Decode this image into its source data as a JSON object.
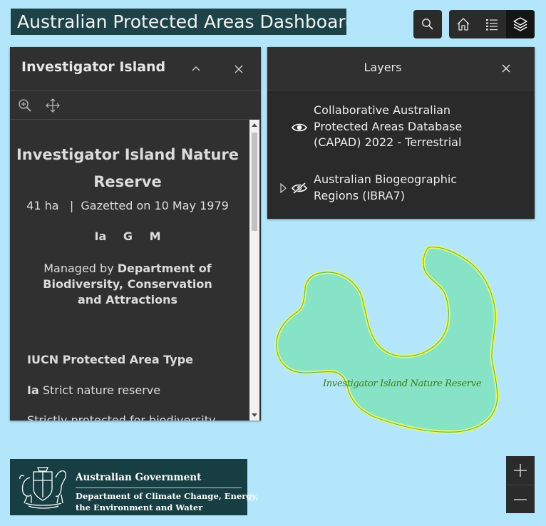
{
  "app": {
    "title": "Australian Protected Areas Dashboard"
  },
  "toolbar": {
    "search_icon": "search-icon",
    "home_icon": "home-icon",
    "legend_icon": "list-icon",
    "layers_icon": "layers-icon"
  },
  "popup": {
    "title": "Investigator Island",
    "feature_name": "Investigator Island Nature Reserve",
    "area": "41 ha",
    "separator": "|",
    "gazetted": "Gazetted on 10 May 1979",
    "codes": [
      "Ia",
      "G",
      "M"
    ],
    "managed_prefix": "Managed by",
    "manager": "Department of Biodiversity, Conservation and Attractions",
    "iucn_heading": "IUCN Protected Area Type",
    "iucn_code": "Ia",
    "iucn_name": "Strict nature reserve",
    "iucn_description": "Strictly protected for biodiversity"
  },
  "layers": {
    "title": "Layers",
    "items": [
      {
        "label": "Collaborative Australian Protected Areas Database (CAPAD) 2022 - Terrestrial",
        "visible": true
      },
      {
        "label": "Australian Biogeographic Regions (IBRA7)",
        "visible": false,
        "expandable": true
      }
    ]
  },
  "map": {
    "feature_label": "Investigator Island Nature Reserve",
    "water_color": "#b3e6fb",
    "island_fill": "#86e3c6",
    "island_outline": "#e2f56a"
  },
  "logo": {
    "government": "Australian Government",
    "department_line1": "Department of Climate Change, Energy,",
    "department_line2": "the Environment and Water"
  }
}
